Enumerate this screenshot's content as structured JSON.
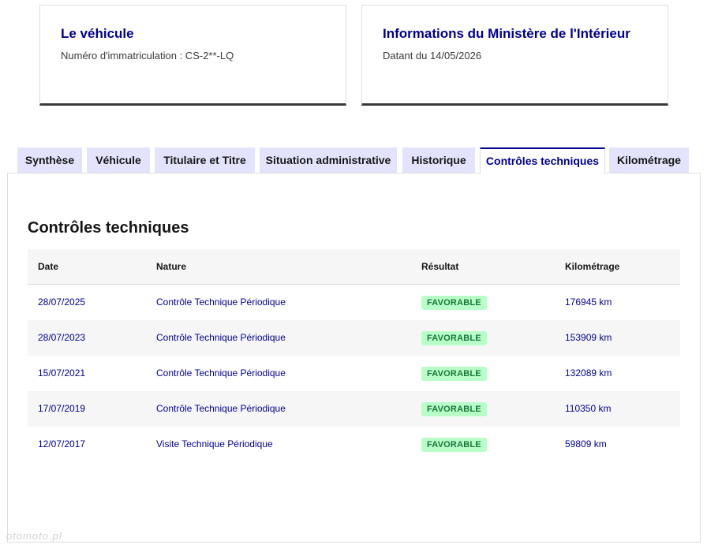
{
  "cards": {
    "vehicle": {
      "title": "Le véhicule",
      "subtitle": "Numéro d'immatriculation : CS-2**-LQ"
    },
    "ministry": {
      "title": "Informations du Ministère de l'Intérieur",
      "subtitle": "Datant du 14/05/2026"
    }
  },
  "tabs": [
    {
      "label": "Synthèse",
      "active": false
    },
    {
      "label": "Véhicule",
      "active": false
    },
    {
      "label": "Titulaire et Titre",
      "active": false
    },
    {
      "label": "Situation administrative",
      "active": false
    },
    {
      "label": "Historique",
      "active": false
    },
    {
      "label": "Contrôles techniques",
      "active": true
    },
    {
      "label": "Kilométrage",
      "active": false
    }
  ],
  "section": {
    "title": "Contrôles techniques"
  },
  "table": {
    "headers": {
      "date": "Date",
      "nature": "Nature",
      "result": "Résultat",
      "km": "Kilométrage"
    },
    "rows": [
      {
        "date": "28/07/2025",
        "nature": "Contrôle Technique Périodique",
        "result": "FAVORABLE",
        "km": "176945 km"
      },
      {
        "date": "28/07/2023",
        "nature": "Contrôle Technique Périodique",
        "result": "FAVORABLE",
        "km": "153909 km"
      },
      {
        "date": "15/07/2021",
        "nature": "Contrôle Technique Périodique",
        "result": "FAVORABLE",
        "km": "132089 km"
      },
      {
        "date": "17/07/2019",
        "nature": "Contrôle Technique Périodique",
        "result": "FAVORABLE",
        "km": "110350 km"
      },
      {
        "date": "12/07/2017",
        "nature": "Visite Technique Périodique",
        "result": "FAVORABLE",
        "km": "59809 km"
      }
    ]
  },
  "watermark": "otomoto.pl",
  "colors": {
    "brand_blue": "#000091",
    "tab_bg": "#e3e3fd",
    "badge_bg": "#b8fec9",
    "badge_text": "#18753c",
    "row_alt": "#f6f6f6"
  }
}
